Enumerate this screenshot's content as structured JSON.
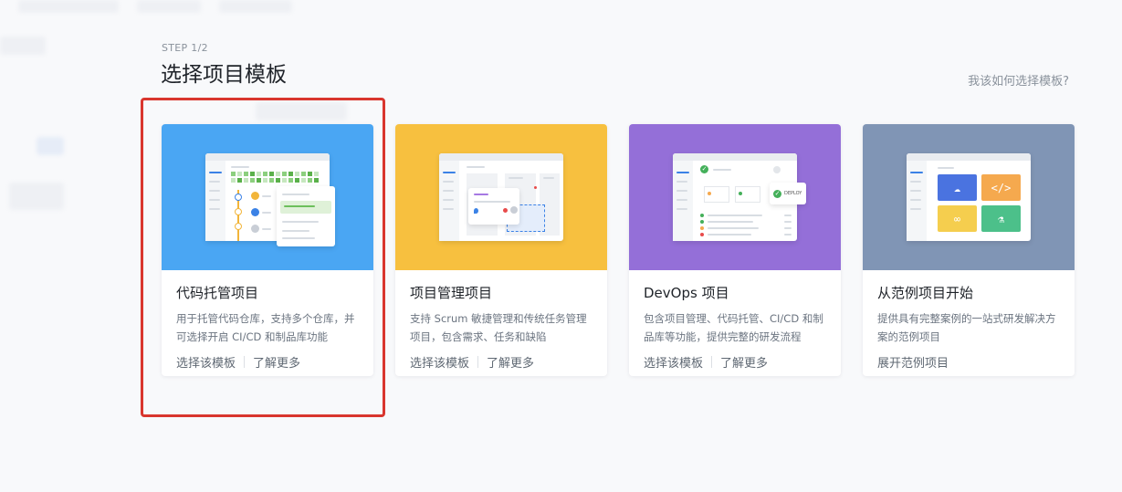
{
  "header": {
    "step": "STEP 1/2",
    "title": "选择项目模板",
    "help_link": "我该如何选择模板?"
  },
  "cards": [
    {
      "title": "代码托管项目",
      "description": "用于托管代码仓库，支持多个仓库，并可选择开启 CI/CD 和制品库功能",
      "actions": [
        "选择该模板",
        "了解更多"
      ],
      "hero_color": "#4aa6f3"
    },
    {
      "title": "项目管理项目",
      "description": "支持 Scrum 敏捷管理和传统任务管理项目，包含需求、任务和缺陷",
      "actions": [
        "选择该模板",
        "了解更多"
      ],
      "hero_color": "#f7c03f"
    },
    {
      "title": "DevOps 项目",
      "description": "包含项目管理、代码托管、CI/CD 和制品库等功能，提供完整的研发流程",
      "actions": [
        "选择该模板",
        "了解更多"
      ],
      "hero_color": "#946fd8",
      "badge": "DEPLOY"
    },
    {
      "title": "从范例项目开始",
      "description": "提供具有完整案例的一站式研发解决方案的范例项目",
      "actions": [
        "展开范例项目"
      ],
      "hero_color": "#8095b5",
      "tile_colors": [
        "#4a73e0",
        "#f5a94e",
        "#f5ce4e",
        "#4cc08a"
      ]
    }
  ]
}
